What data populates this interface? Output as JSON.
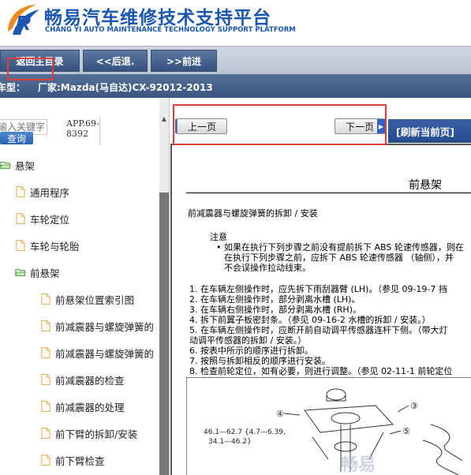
{
  "header": {
    "title_cn": "畅易汽车维修技术支持平台",
    "title_en": "CHANG YI AUTO MAINTENANCE TECHNOLOGY SUPPORT PLATFORM",
    "logo_icon": "cy-r-logo-icon"
  },
  "nav": {
    "home": "返回主目录",
    "back": "<<后退.",
    "forward": ">>前进"
  },
  "car_info": {
    "label": "车型：",
    "value": "厂家:Mazda(马自达)CX-92012-2013"
  },
  "search": {
    "placeholder": "输入关键字",
    "button": "查询",
    "app_code": "APP.69-8392"
  },
  "tree": {
    "root": "悬架",
    "items": [
      {
        "label": "通用程序",
        "level": 1
      },
      {
        "label": "车轮定位",
        "level": 1
      },
      {
        "label": "车轮与轮胎",
        "level": 1
      },
      {
        "label": "前悬架",
        "level": 1,
        "open": true
      },
      {
        "label": "前悬架位置索引图",
        "level": 2
      },
      {
        "label": "前减震器与螺旋弹簧的",
        "level": 2
      },
      {
        "label": "前减震器与螺旋弹簧的",
        "level": 2
      },
      {
        "label": "前减震器的检查",
        "level": 2
      },
      {
        "label": "前减震器的处理",
        "level": 2
      },
      {
        "label": "前下臂的拆卸/安装",
        "level": 2
      },
      {
        "label": "前下臂检查",
        "level": 2
      }
    ]
  },
  "pager": {
    "prev": "上一页",
    "next": "下一页",
    "refresh": "[刷新当前页]"
  },
  "doc": {
    "title": "前悬架",
    "subtitle": "前减震器与螺旋弹簧的拆卸 / 安装",
    "note_label": "注意",
    "note_lines": [
      "• 如果在执行下列步骤之前没有提前拆下 ABS 轮速传感器，则在",
      "在执行下列步骤之前，应拆下 ABS 轮速传感器 （轴侧），并",
      "不会误操作拉动线束。"
    ],
    "steps": [
      "1. 在车辆左侧操作时，应先拆下雨刮器臂 (LH)。（参见 09-19-7 挡",
      "2. 在车辆左侧操作时，部分剥离水槽 (LH)。",
      "3. 在车辆右侧操作时，部分剥离水槽 (RH)。",
      "4. 拆下前翼子板密封条。（参见 09-16-2 水槽的拆卸 / 安装。）",
      "5. 在车辆左侧操作时，应断开前自动调平传感器连杆下侧。（带大灯",
      "   动调平传感器的拆卸 / 安装。）",
      "6. 按表中所示的顺序进行拆卸。",
      "7. 按照与拆卸相反的顺序进行安装。",
      "8. 检查前轮定位，如有必要，则进行调整。（参见 02-11-1 前轮定位"
    ],
    "diagram": {
      "torque_1": "46.1—62.7 {4.7—6.39,",
      "torque_2": "34.1—46.2}",
      "callouts": [
        "③",
        "④",
        "⑤"
      ],
      "watermark": "畅易"
    }
  }
}
